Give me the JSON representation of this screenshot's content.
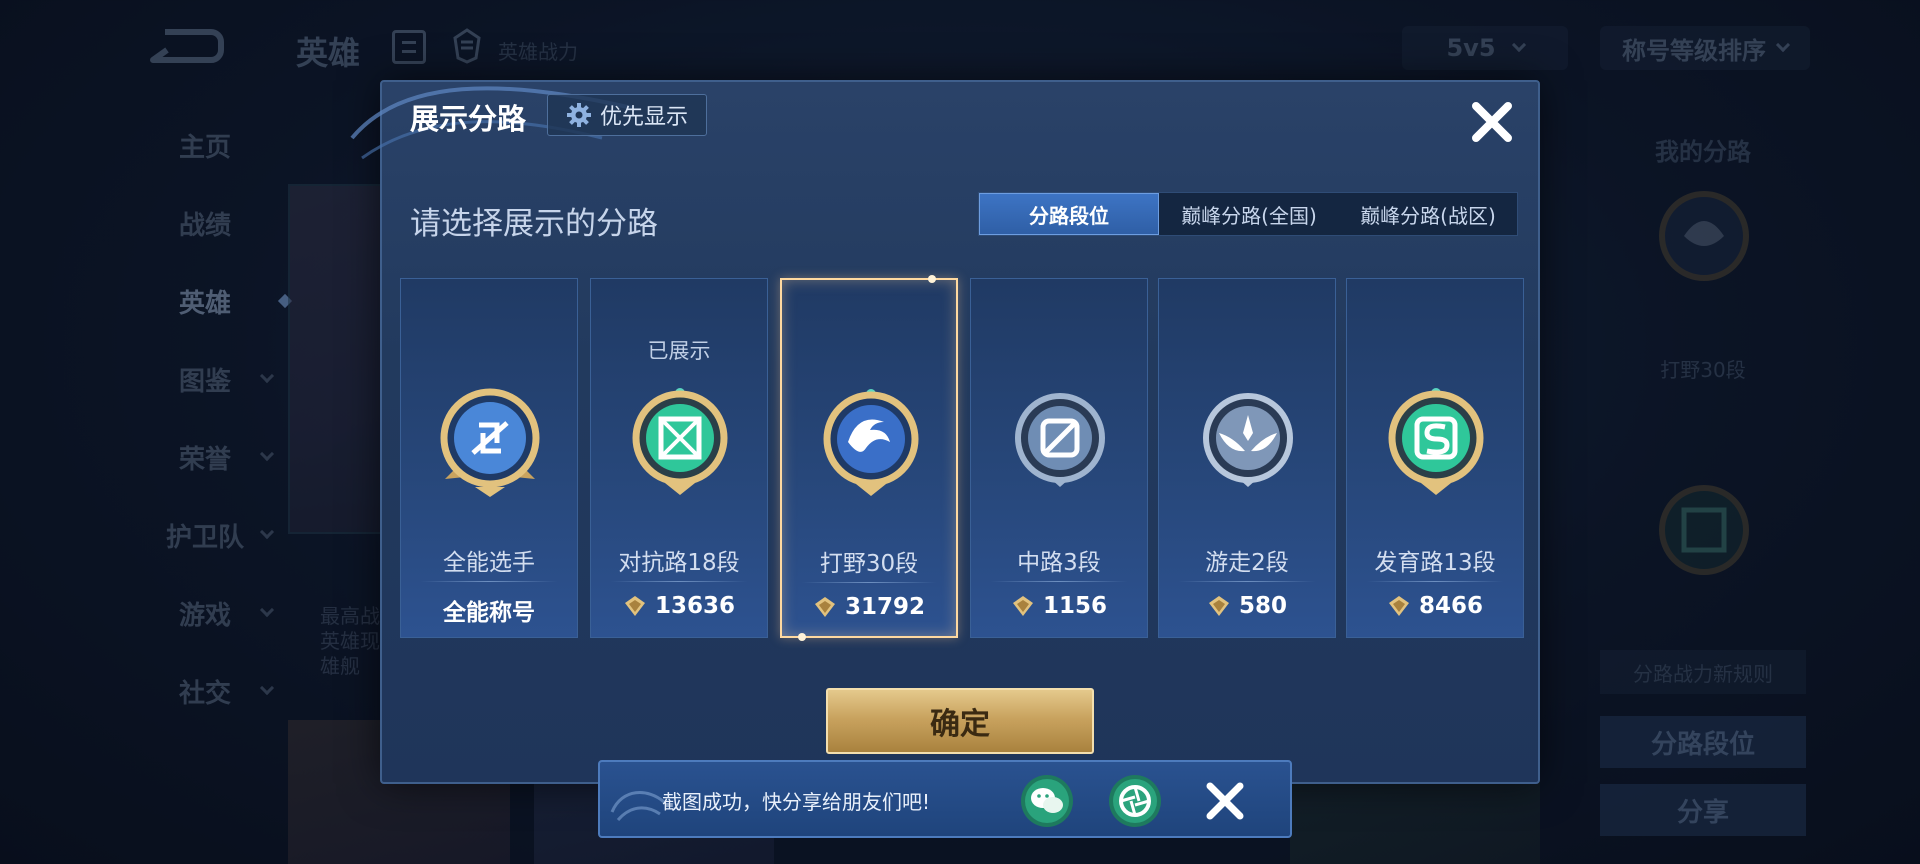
{
  "app": {
    "title": "英雄",
    "power_label": "英雄战力",
    "mode": "5v5",
    "sort": "称号等级排序"
  },
  "nav": [
    {
      "label": "主页",
      "has_chevron": false,
      "active": false
    },
    {
      "label": "战绩",
      "has_chevron": false,
      "active": false
    },
    {
      "label": "英雄",
      "has_chevron": false,
      "active": true
    },
    {
      "label": "图鉴",
      "has_chevron": true,
      "active": false
    },
    {
      "label": "荣誉",
      "has_chevron": true,
      "active": false
    },
    {
      "label": "护卫队",
      "has_chevron": true,
      "active": false
    },
    {
      "label": "游戏",
      "has_chevron": true,
      "active": false
    },
    {
      "label": "社交",
      "has_chevron": true,
      "active": false
    }
  ],
  "background": {
    "desc_lines": "最高战力 英雄现 英雄舰"
  },
  "right_panel": {
    "title": "我的分路",
    "label": "打野30段",
    "rule_button": "分路战力新规则",
    "main_button": "分路段位",
    "share_button": "分享"
  },
  "modal": {
    "title": "展示分路",
    "priority_button": "优先显示",
    "subtitle": "请选择展示的分路",
    "tabs": [
      {
        "label": "分路段位",
        "active": true
      },
      {
        "label": "巅峰分路(全国)",
        "active": false
      },
      {
        "label": "巅峰分路(战区)",
        "active": false
      }
    ],
    "cards": [
      {
        "name": "全能选手",
        "score": "全能称号",
        "shown": "",
        "badge": "all-rounder-badge-icon",
        "color": "#4a87d8",
        "selected": false,
        "has_score_icon": false
      },
      {
        "name": "对抗路18段",
        "score": "13636",
        "shown": "已展示",
        "badge": "clash-lane-badge-icon",
        "color": "#2fc79a",
        "selected": false,
        "has_score_icon": true
      },
      {
        "name": "打野30段",
        "score": "31792",
        "shown": "",
        "badge": "jungle-badge-icon",
        "color": "#3a6fc8",
        "selected": true,
        "has_score_icon": true
      },
      {
        "name": "中路3段",
        "score": "1156",
        "shown": "",
        "badge": "mid-lane-badge-icon",
        "color": "#8fa6c2",
        "selected": false,
        "has_score_icon": true
      },
      {
        "name": "游走2段",
        "score": "580",
        "shown": "",
        "badge": "roam-badge-icon",
        "color": "#9fb4cf",
        "selected": false,
        "has_score_icon": true
      },
      {
        "name": "发育路13段",
        "score": "8466",
        "shown": "",
        "badge": "farm-lane-badge-icon",
        "color": "#2fc79a",
        "selected": false,
        "has_score_icon": true
      }
    ],
    "confirm_button": "确定"
  },
  "toast": {
    "text": "截图成功，快分享给朋友们吧!"
  },
  "colors": {
    "gold": "#e2c27e",
    "accent_blue": "#3d74c4",
    "selected_border": "#ffd9a0"
  }
}
